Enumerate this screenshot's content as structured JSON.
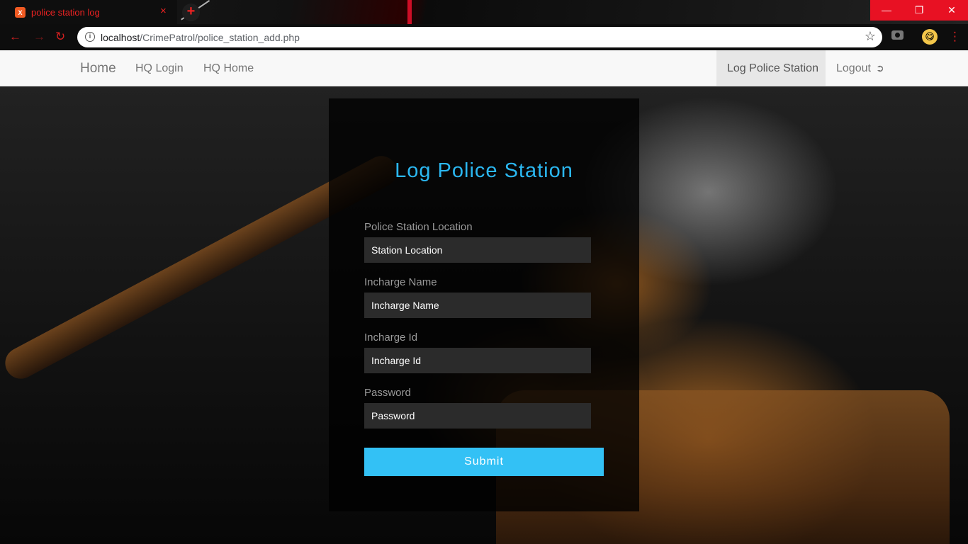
{
  "browser": {
    "tab_title": "police station log",
    "favicon_label": "X",
    "tab_close": "×",
    "new_tab": "+",
    "url_host": "localhost",
    "url_path": "/CrimePatrol/police_station_add.php",
    "window_controls": {
      "minimize": "—",
      "restore": "❐",
      "close": "✕"
    },
    "icons": [
      "back-icon",
      "forward-icon",
      "reload-icon",
      "info-icon",
      "star-icon",
      "camera-icon",
      "avatar",
      "menu-icon"
    ]
  },
  "navbar": {
    "brand": "Home",
    "links": [
      "HQ Login",
      "HQ Home"
    ],
    "active_link": "Log Police Station",
    "logout": "Logout"
  },
  "form": {
    "title": "Log Police Station",
    "fields": [
      {
        "label": "Police Station Location",
        "placeholder": "Station Location"
      },
      {
        "label": "Incharge Name",
        "placeholder": "Incharge Name"
      },
      {
        "label": "Incharge Id",
        "placeholder": "Incharge Id"
      },
      {
        "label": "Password",
        "placeholder": "Password"
      }
    ],
    "submit_label": "Submit"
  },
  "colors": {
    "accent": "#33c1f5",
    "title": "#2bb7f0",
    "browser_accent": "#e81123"
  }
}
